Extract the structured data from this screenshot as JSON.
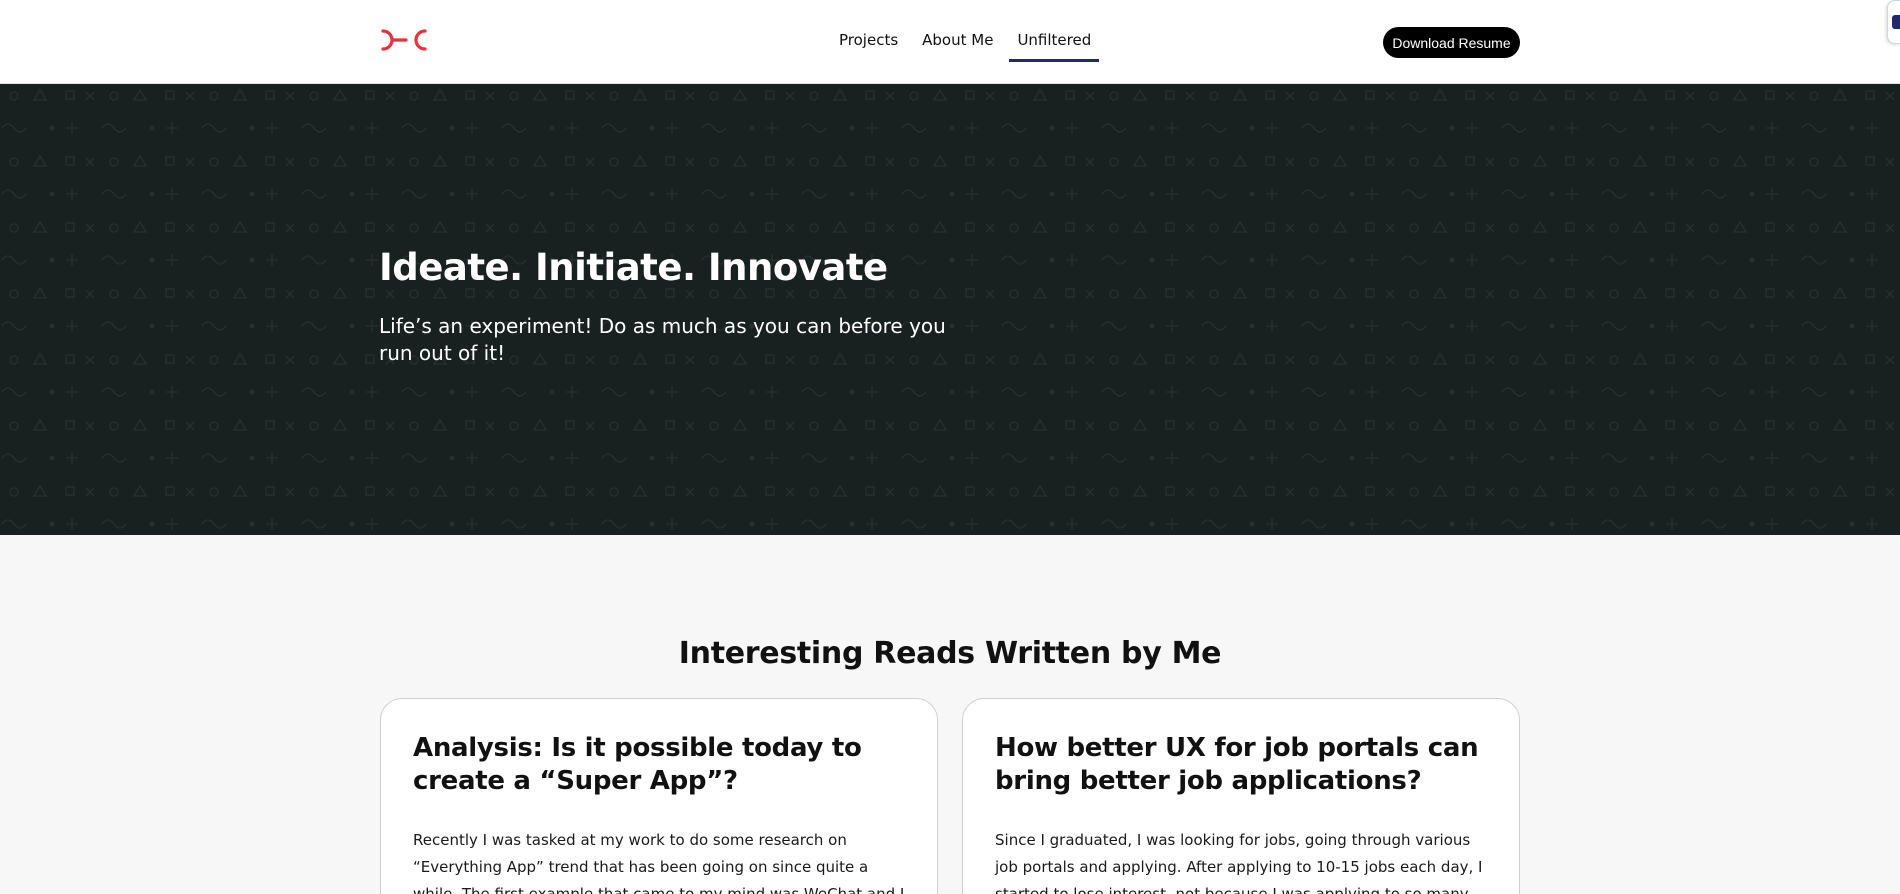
{
  "nav": {
    "logo_alt": "CC",
    "links": [
      "Projects",
      "About Me",
      "Unfiltered"
    ],
    "active": "Unfiltered",
    "download_label": "Download Resume"
  },
  "hero": {
    "title": "Ideate. Initiate. Innovate",
    "subtitle": "Life’s an experiment! Do as much as you can before you run out of it!"
  },
  "reads": {
    "heading": "Interesting Reads Written by Me",
    "articles": [
      {
        "title": "Analysis: Is it possible today to create a “Super App”?",
        "excerpt": "Recently I was tasked at my work to do some research on “Everything App” trend that has been going on since quite a while. The first example that came to my mind was WeChat and I immediately became very"
      },
      {
        "title": "How better UX for job portals can bring better job applications?",
        "excerpt": "Since I graduated, I was looking for jobs, going through various job portals and applying. After applying to 10-15 jobs each day, I started to lose interest, not because I was applying to so many jobs each day, but"
      }
    ]
  },
  "colors": {
    "brand_red": "#e8313a",
    "hero_bg": "#18211f",
    "nav_active": "#1f2a6e"
  }
}
